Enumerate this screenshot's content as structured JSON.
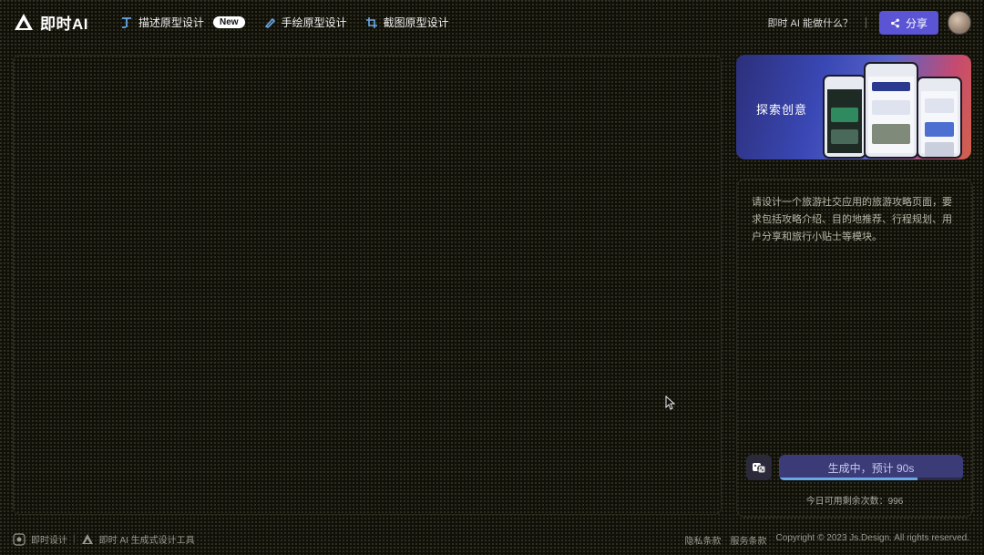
{
  "header": {
    "logo_text": "即时AI",
    "nav": [
      {
        "label": "描述原型设计",
        "badge": "New",
        "icon": "text-prototype-icon"
      },
      {
        "label": "手绘原型设计",
        "icon": "pen-icon"
      },
      {
        "label": "截图原型设计",
        "icon": "screenshot-icon"
      }
    ],
    "help_link": "即时 AI 能做什么？",
    "share_label": "分享"
  },
  "banner": {
    "title": "探索创意"
  },
  "prompt": {
    "text": "请设计一个旅游社交应用的旅游攻略页面，要求包括攻略介绍、目的地推荐、行程规划、用户分享和旅行小贴士等模块。"
  },
  "generate": {
    "label": "生成中，预计 90s",
    "progress": 0.75,
    "remaining": "今日可用剩余次数：996"
  },
  "footer": {
    "brand": "即时设计",
    "tool": "即时 AI 生成式设计工具",
    "privacy": "隐私条款",
    "terms": "服务条款",
    "copyright": "Copyright © 2023 Js.Design. All rights reserved."
  },
  "colors": {
    "accent": "#5b55d6",
    "generate_bg": "#3b3b78",
    "progress": "#6aa7e6"
  }
}
